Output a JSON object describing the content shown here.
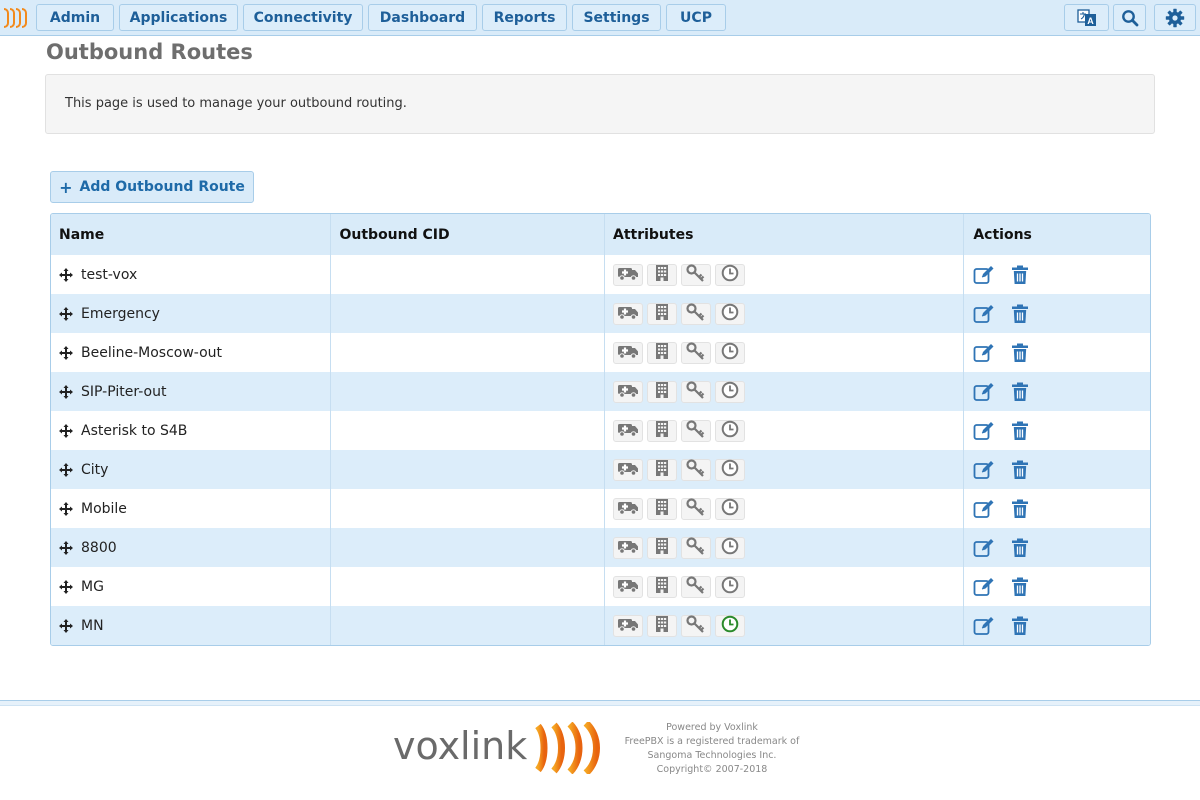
{
  "nav": {
    "items": [
      {
        "label": "Admin"
      },
      {
        "label": "Applications"
      },
      {
        "label": "Connectivity"
      },
      {
        "label": "Dashboard"
      },
      {
        "label": "Reports"
      },
      {
        "label": "Settings"
      },
      {
        "label": "UCP"
      }
    ],
    "icons": [
      "translate-icon",
      "search-icon",
      "gear-icon"
    ]
  },
  "page": {
    "title": "Outbound Routes",
    "description": "This page is used to manage your outbound routing."
  },
  "add_button": {
    "label": "Add Outbound Route"
  },
  "table": {
    "headers": {
      "name": "Name",
      "cid": "Outbound CID",
      "attributes": "Attributes",
      "actions": "Actions"
    },
    "rows": [
      {
        "name": "test-vox",
        "cid": ""
      },
      {
        "name": "Emergency",
        "cid": ""
      },
      {
        "name": "Beeline-Moscow-out",
        "cid": ""
      },
      {
        "name": "SIP-Piter-out",
        "cid": ""
      },
      {
        "name": "Asterisk to S4B",
        "cid": ""
      },
      {
        "name": "City",
        "cid": ""
      },
      {
        "name": "Mobile",
        "cid": ""
      },
      {
        "name": "8800",
        "cid": ""
      },
      {
        "name": "MG",
        "cid": ""
      },
      {
        "name": "MN",
        "cid": ""
      }
    ]
  },
  "colors": {
    "accent": "#1e6aa8",
    "nav_bg": "#d9ebf9",
    "brand_orange": "#f28a1c",
    "time_active": "#2a8a2a"
  },
  "footer": {
    "brand": "voxlink",
    "lines": [
      "Powered by Voxlink",
      "FreePBX is a registered trademark of",
      "Sangoma Technologies Inc.",
      "Copyright© 2007-2018"
    ]
  }
}
